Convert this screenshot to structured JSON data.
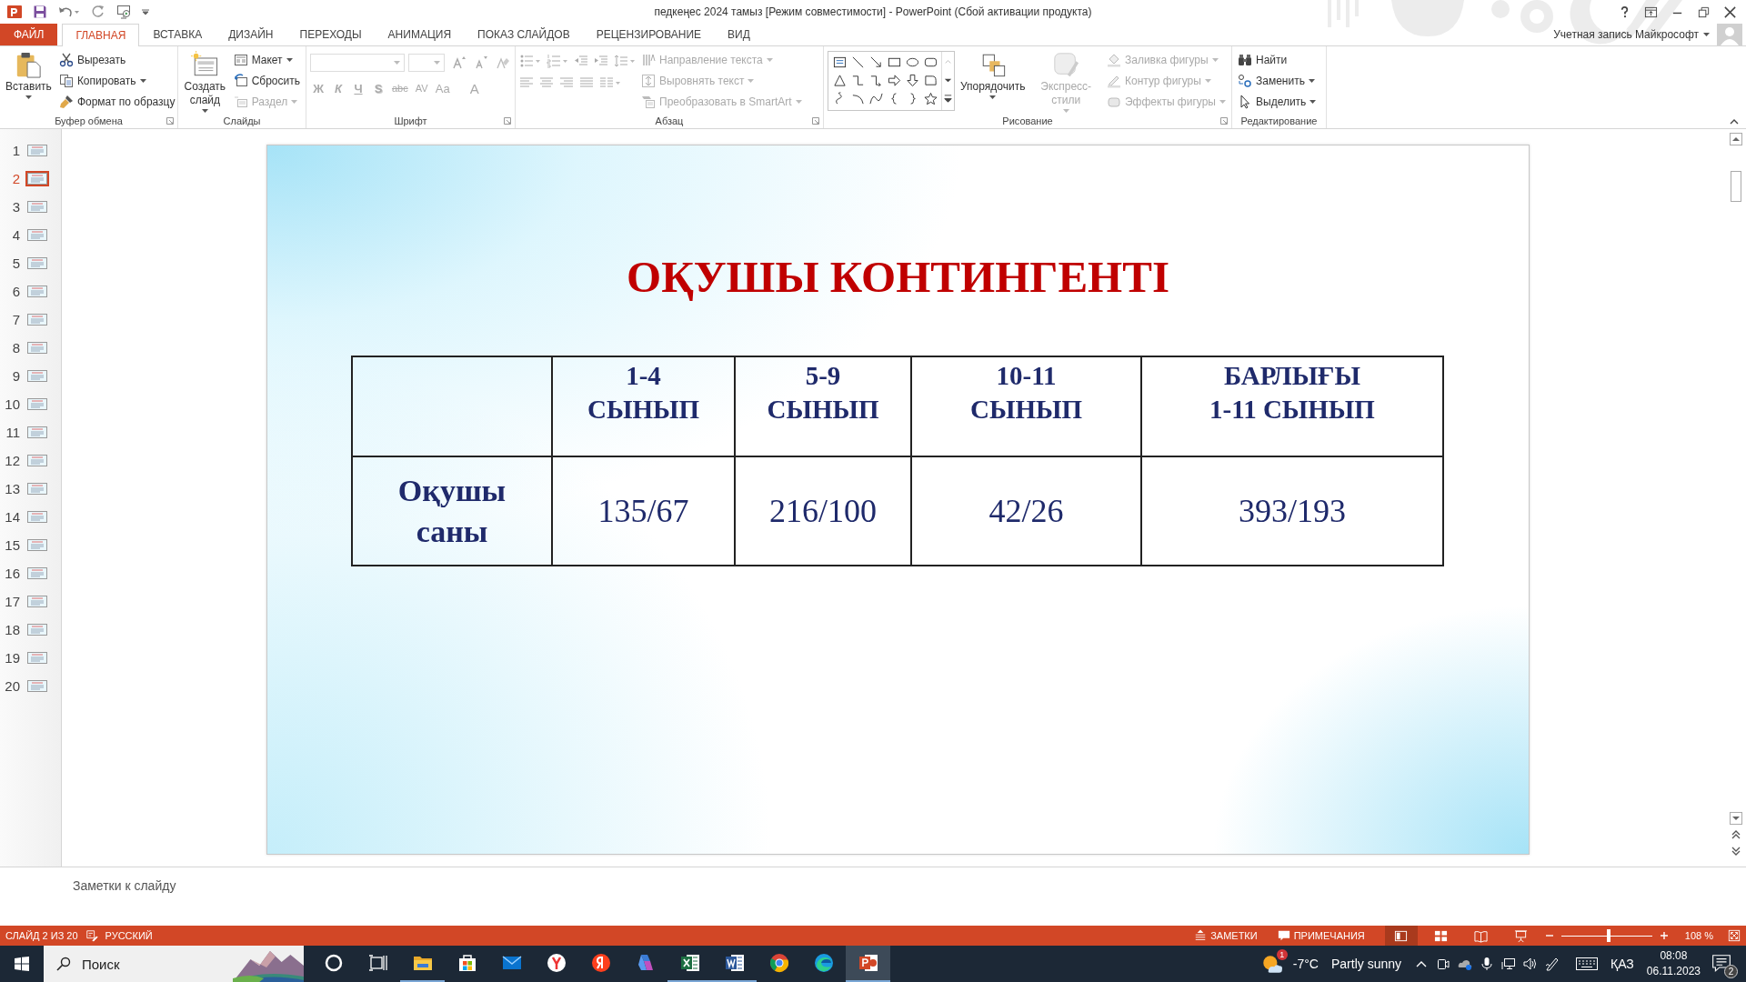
{
  "window": {
    "title": "педкеңес 2024 тамыз [Режим совместимости] - PowerPoint (Сбой активации продукта)",
    "account": "Учетная запись Майкрософт"
  },
  "tabs": [
    {
      "label": "ФАЙЛ",
      "kind": "file",
      "selected": false
    },
    {
      "label": "ГЛАВНАЯ",
      "kind": "tab",
      "selected": true
    },
    {
      "label": "ВСТАВКА",
      "kind": "tab",
      "selected": false
    },
    {
      "label": "ДИЗАЙН",
      "kind": "tab",
      "selected": false
    },
    {
      "label": "ПЕРЕХОДЫ",
      "kind": "tab",
      "selected": false
    },
    {
      "label": "АНИМАЦИЯ",
      "kind": "tab",
      "selected": false
    },
    {
      "label": "ПОКАЗ СЛАЙДОВ",
      "kind": "tab",
      "selected": false
    },
    {
      "label": "РЕЦЕНЗИРОВАНИЕ",
      "kind": "tab",
      "selected": false
    },
    {
      "label": "ВИД",
      "kind": "tab",
      "selected": false
    }
  ],
  "ribbon_groups": [
    {
      "label": "Буфер обмена",
      "kind": "standard",
      "launcher": true,
      "large": [
        {
          "label": "Вставить",
          "dropdown": true,
          "disabled": false
        }
      ],
      "small": [
        {
          "label": "Вырезать",
          "dropdown": false,
          "disabled": false
        },
        {
          "label": "Копировать",
          "dropdown": true,
          "disabled": false
        },
        {
          "label": "Формат по образцу",
          "dropdown": false,
          "disabled": false
        }
      ]
    },
    {
      "label": "Слайды",
      "kind": "standard",
      "launcher": false,
      "large": [
        {
          "label": "Создать слайд",
          "dropdown": true,
          "disabled": false
        }
      ],
      "small": [
        {
          "label": "Макет",
          "dropdown": true,
          "disabled": false
        },
        {
          "label": "Сбросить",
          "dropdown": false,
          "disabled": false
        },
        {
          "label": "Раздел",
          "dropdown": true,
          "disabled": true
        }
      ]
    },
    {
      "label": "Шрифт",
      "kind": "font",
      "launcher": true,
      "glyphs": [
        {
          "label": "Ж",
          "disabled": true
        },
        {
          "label": "К",
          "disabled": true
        },
        {
          "label": "Ч",
          "disabled": true
        },
        {
          "label": "S",
          "disabled": true
        },
        {
          "label": "abc",
          "disabled": true
        },
        {
          "label": "AV",
          "disabled": true
        },
        {
          "label": "Aa",
          "disabled": true
        },
        {
          "label": "A",
          "disabled": true
        }
      ]
    },
    {
      "label": "Абзац",
      "kind": "paragraph",
      "launcher": true,
      "small": [
        {
          "label": "Направление текста",
          "dropdown": true,
          "disabled": true
        },
        {
          "label": "Выровнять текст",
          "dropdown": true,
          "disabled": true
        },
        {
          "label": "Преобразовать в SmartArt",
          "dropdown": true,
          "disabled": true
        }
      ]
    },
    {
      "label": "Рисование",
      "kind": "drawing",
      "launcher": true,
      "large": [
        {
          "label": "Упорядочить",
          "dropdown": true,
          "disabled": false
        },
        {
          "label": "Экспресс-стили",
          "dropdown": true,
          "disabled": true
        }
      ],
      "small": [
        {
          "label": "Заливка фигуры",
          "dropdown": true,
          "disabled": true
        },
        {
          "label": "Контур фигуры",
          "dropdown": true,
          "disabled": true
        },
        {
          "label": "Эффекты фигуры",
          "dropdown": true,
          "disabled": true
        }
      ]
    },
    {
      "label": "Редактирование",
      "kind": "standard",
      "launcher": false,
      "small": [
        {
          "label": "Найти",
          "dropdown": false,
          "disabled": false
        },
        {
          "label": "Заменить",
          "dropdown": true,
          "disabled": false
        },
        {
          "label": "Выделить",
          "dropdown": true,
          "disabled": false
        }
      ]
    }
  ],
  "thumbnails": [
    {
      "number": "1",
      "selected": false
    },
    {
      "number": "2",
      "selected": true
    },
    {
      "number": "3",
      "selected": false
    },
    {
      "number": "4",
      "selected": false
    },
    {
      "number": "5",
      "selected": false
    },
    {
      "number": "6",
      "selected": false
    },
    {
      "number": "7",
      "selected": false
    },
    {
      "number": "8",
      "selected": false
    },
    {
      "number": "9",
      "selected": false
    },
    {
      "number": "10",
      "selected": false
    },
    {
      "number": "11",
      "selected": false
    },
    {
      "number": "12",
      "selected": false
    },
    {
      "number": "13",
      "selected": false
    },
    {
      "number": "14",
      "selected": false
    },
    {
      "number": "15",
      "selected": false
    },
    {
      "number": "16",
      "selected": false
    },
    {
      "number": "17",
      "selected": false
    },
    {
      "number": "18",
      "selected": false
    },
    {
      "number": "19",
      "selected": false
    },
    {
      "number": "20",
      "selected": false
    }
  ],
  "slide": {
    "title": "ОҚУШЫ КОНТИНГЕНТІ",
    "table": {
      "header": [
        "1-4\nСЫНЫП",
        "5-9\nСЫНЫП",
        "10-11\nСЫНЫП",
        "БАРЛЫҒЫ\n1-11 СЫНЫП"
      ],
      "rows": [
        [
          "Оқушы\nсаны",
          "135/67",
          "216/100",
          "42/26",
          "393/193"
        ]
      ]
    }
  },
  "notes": {
    "placeholder": "Заметки к слайду"
  },
  "status_bar": {
    "slide": "СЛАЙД 2 ИЗ 20",
    "language": "РУССКИЙ",
    "notes": "ЗАМЕТКИ",
    "comments": "ПРИМЕЧАНИЯ",
    "views": [
      {
        "kind": "normal",
        "selected": true
      },
      {
        "kind": "sorter",
        "selected": false
      },
      {
        "kind": "reading",
        "selected": false
      },
      {
        "kind": "show",
        "selected": false
      }
    ],
    "zoom": {
      "level": 0.52,
      "reading": "108 %"
    }
  },
  "taskbar": {
    "search": {
      "placeholder": "Поиск"
    },
    "apps": [
      {
        "kind": "cortana",
        "running": false,
        "selected": false
      },
      {
        "kind": "taskview",
        "running": false,
        "selected": false
      },
      {
        "kind": "explorer",
        "running": true,
        "selected": false
      },
      {
        "kind": "store",
        "running": false,
        "selected": false
      },
      {
        "kind": "mail",
        "running": false,
        "selected": false
      },
      {
        "kind": "yandexbrowser",
        "running": false,
        "selected": false
      },
      {
        "kind": "yandex",
        "running": false,
        "selected": false
      },
      {
        "kind": "copilot",
        "running": false,
        "selected": false
      },
      {
        "kind": "excel",
        "running": true,
        "selected": false
      },
      {
        "kind": "word",
        "running": true,
        "selected": false
      },
      {
        "kind": "chrome",
        "running": false,
        "selected": false
      },
      {
        "kind": "edge",
        "running": false,
        "selected": false
      },
      {
        "kind": "powerpoint",
        "running": true,
        "selected": true
      }
    ],
    "weather": {
      "badge": "1",
      "temperature": "-7°C",
      "condition": "Partly sunny"
    },
    "language": "ҚАЗ",
    "time": "08:08",
    "date": "06.11.2023",
    "notifications": "2"
  }
}
